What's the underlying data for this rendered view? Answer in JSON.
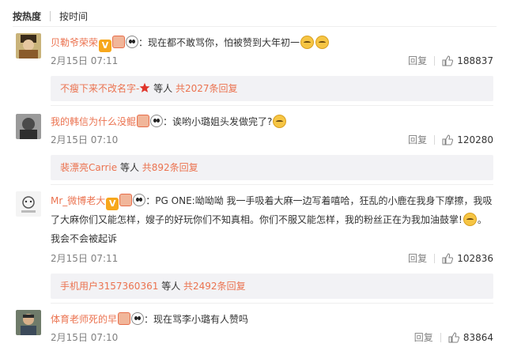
{
  "sort": {
    "hot": "按热度",
    "time": "按时间"
  },
  "comments": [
    {
      "user": "贝勒爷荣荣",
      "text": "：现在都不敢骂你，怕被赞到大年初一",
      "date": "2月15日 07:11",
      "reply_label": "回复",
      "likes": "188837",
      "sub": {
        "name": "不瘦下来不改名字-",
        "people": "等人",
        "count_text": "共2027条回复"
      },
      "badges": [
        "vip-icon",
        "fan-icon",
        "panda-icon"
      ]
    },
    {
      "user": "我的韩信为什么没鲲",
      "text": "：诶哟小璐姐头发做完了?",
      "date": "2月15日 07:10",
      "reply_label": "回复",
      "likes": "120280",
      "sub": {
        "name": "裴漂亮Carrie",
        "people": "等人",
        "count_text": "共892条回复"
      }
    },
    {
      "user": "Mr_微博老大",
      "text": "：PG ONE:呦呦呦 我一手吸着大麻一边写着嘻哈，狂乱的小鹿在我身下摩擦，我吸了大麻你们又能怎样，嫂子的好玩你们不知真相。你们不服又能怎样，我的粉丝正在为我加油鼓掌!",
      "text_tail": "。我会不会被起诉",
      "date": "2月15日 07:11",
      "reply_label": "回复",
      "likes": "102836",
      "sub": {
        "name": "手机用户3157360361",
        "people": "等人",
        "count_text": "共2492条回复"
      }
    },
    {
      "user": "体育老师死的早",
      "text": "：现在骂李小璐有人赞吗",
      "date": "2月15日 07:10",
      "reply_label": "回复",
      "likes": "83864"
    }
  ],
  "colors": {
    "username": "#eb7350",
    "meta": "#808080",
    "sub_bg": "#f2f2f5"
  }
}
